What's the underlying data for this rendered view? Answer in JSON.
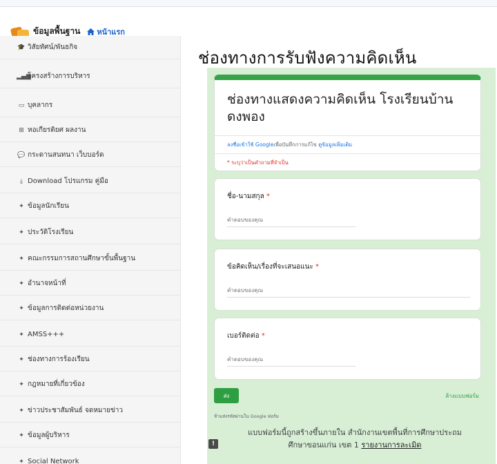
{
  "header": {
    "brand_label": "ข้อมูลพื้นฐาน",
    "home_label": "หน้าแรก"
  },
  "sidebar": {
    "items": [
      {
        "label": "วิสัยทัศน์/พันธกิจ",
        "icon": "graduation-cap-icon",
        "glyph": "🎓"
      },
      {
        "label": "โครงสร้างการบริหาร",
        "icon": "bar-chart-icon",
        "glyph": "▂▄▆"
      },
      {
        "label": "บุคลากร",
        "icon": "id-card-icon",
        "glyph": "▭"
      },
      {
        "label": "หอเกียรติยศ ผลงาน",
        "icon": "sitemap-icon",
        "glyph": "⊞"
      },
      {
        "label": "กระดานสนทนา เว็บบอร์ด",
        "icon": "comments-icon",
        "glyph": "💬"
      },
      {
        "label": "Download โปรแกรม คู่มือ",
        "icon": "download-icon",
        "glyph": "⤓"
      },
      {
        "label": "ข้อมูลนักเรียน",
        "icon": "puzzle-icon",
        "glyph": "✦"
      },
      {
        "label": "ประวัติโรงเรียน",
        "icon": "puzzle-icon",
        "glyph": "✦"
      },
      {
        "label": "คณะกรรมการสถานศึกษาขั้นพื้นฐาน",
        "icon": "puzzle-icon",
        "glyph": "✦"
      },
      {
        "label": "อำนาจหน้าที่",
        "icon": "puzzle-icon",
        "glyph": "✦"
      },
      {
        "label": "ข้อมูลการติดต่อหน่วยงาน",
        "icon": "puzzle-icon",
        "glyph": "✦"
      },
      {
        "label": "AMSS+++",
        "icon": "puzzle-icon",
        "glyph": "✦"
      },
      {
        "label": "ช่องทางการร้องเรียน",
        "icon": "puzzle-icon",
        "glyph": "✦"
      },
      {
        "label": "กฎหมายที่เกี่ยวข้อง",
        "icon": "puzzle-icon",
        "glyph": "✦"
      },
      {
        "label": "ข่าวประชาสัมพันธ์ จดหมายข่าว",
        "icon": "puzzle-icon",
        "glyph": "✦"
      },
      {
        "label": "ข้อมูลผู้บริหาร",
        "icon": "puzzle-icon",
        "glyph": "✦"
      },
      {
        "label": "Social Network",
        "icon": "puzzle-icon",
        "glyph": "✦"
      }
    ]
  },
  "page": {
    "title": "ช่องทางการรับฟังความคิดเห็น"
  },
  "form": {
    "title": "ช่องทางแสดงความคิดเห็น โรงเรียนบ้านดงพอง",
    "signin_prefix": "ลงชื่อเข้าใช้ Google",
    "signin_middle": "เพื่อบันทึกการแก้ไข",
    "signin_more": "ดูข้อมูลเพิ่มเติม",
    "required_note": "* ระบุว่าเป็นคำถามที่จำเป็น",
    "questions": [
      {
        "label": "ชื่อ-นามสกุล",
        "required": "*",
        "placeholder": "คำตอบของคุณ"
      },
      {
        "label": "ข้อคิดเห็น/เรื่องที่จะเสนอแนะ",
        "required": "*",
        "placeholder": "คำตอบของคุณ"
      },
      {
        "label": "เบอร์ติดต่อ",
        "required": "*",
        "placeholder": "คำตอบของคุณ"
      }
    ],
    "submit_label": "ส่ง",
    "clear_label": "ล้างแบบฟอร์ม",
    "password_note": "ห้ามส่งรหัสผ่านใน Google ฟอร์ม",
    "footer_line1": "แบบฟอร์มนี้ถูกสร้างขึ้นภายใน สำนักงานเขตพื้นที่การศึกษาประถม",
    "footer_line2": "ศึกษาขอนแก่น เขต 1",
    "report_label": "รายงานการละเมิด",
    "report_icon_glyph": "!"
  }
}
